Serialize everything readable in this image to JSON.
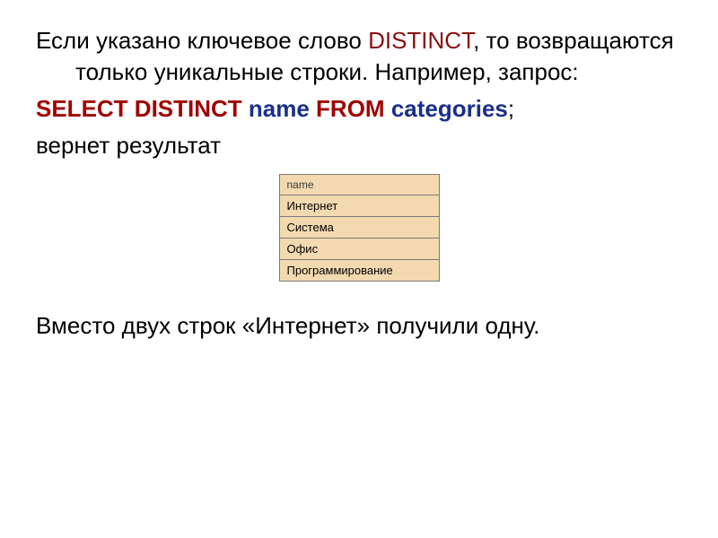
{
  "para1": {
    "prefix": "Если  указано ключевое слово ",
    "keyword": "DISTINCT",
    "suffix": ", то возвращаются только уникальные строки. Например, запрос:"
  },
  "sql": {
    "select": "SELECT DISTINCT",
    "name": " name ",
    "from": "FROM",
    "categories": " categories",
    "semicolon": ";"
  },
  "para2": "вернет результат",
  "table": {
    "header": "name",
    "rows": [
      "Интернет",
      "Система",
      "Офис",
      "Программирование"
    ]
  },
  "para3": "Вместо двух строк «Интернет» получили одну."
}
